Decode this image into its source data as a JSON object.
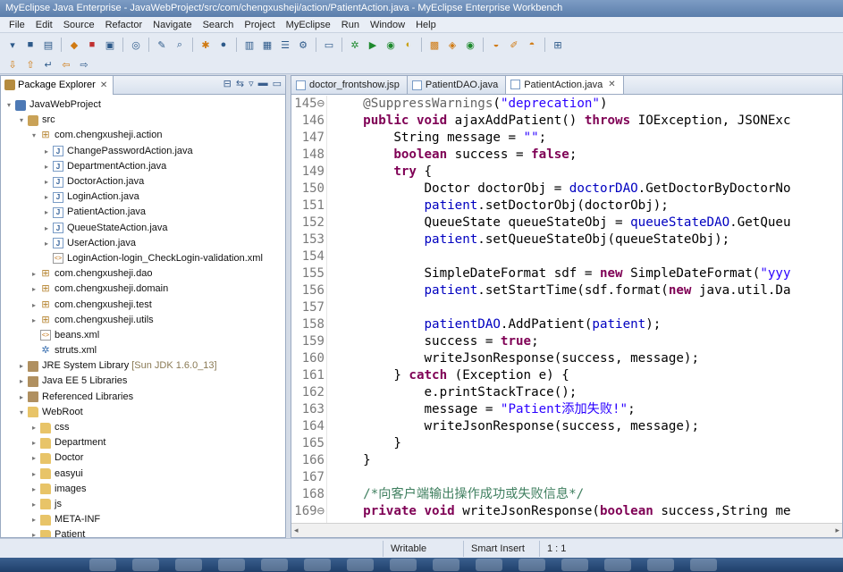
{
  "window": {
    "title": "MyEclipse Java Enterprise - JavaWebProject/src/com/chengxusheji/action/PatientAction.java - MyEclipse Enterprise Workbench"
  },
  "menu": [
    "File",
    "Edit",
    "Source",
    "Refactor",
    "Navigate",
    "Search",
    "Project",
    "MyEclipse",
    "Run",
    "Window",
    "Help"
  ],
  "explorer": {
    "title": "Package Explorer",
    "close": "✕",
    "items": [
      {
        "label": "JavaWebProject",
        "twisty": "▾",
        "icon": "project-icon",
        "indent": 0
      },
      {
        "label": "src",
        "twisty": "▾",
        "icon": "source-folder-icon",
        "indent": 1
      },
      {
        "label": "com.chengxusheji.action",
        "twisty": "▾",
        "icon": "package-icon",
        "indent": 2
      },
      {
        "label": "ChangePasswordAction.java",
        "twisty": "▸",
        "icon": "java-file-icon",
        "indent": 3
      },
      {
        "label": "DepartmentAction.java",
        "twisty": "▸",
        "icon": "java-file-icon",
        "indent": 3
      },
      {
        "label": "DoctorAction.java",
        "twisty": "▸",
        "icon": "java-file-icon",
        "indent": 3
      },
      {
        "label": "LoginAction.java",
        "twisty": "▸",
        "icon": "java-file-icon",
        "indent": 3
      },
      {
        "label": "PatientAction.java",
        "twisty": "▸",
        "icon": "java-file-icon",
        "indent": 3
      },
      {
        "label": "QueueStateAction.java",
        "twisty": "▸",
        "icon": "java-file-icon",
        "indent": 3
      },
      {
        "label": "UserAction.java",
        "twisty": "▸",
        "icon": "java-file-icon",
        "indent": 3
      },
      {
        "label": "LoginAction-login_CheckLogin-validation.xml",
        "twisty": "",
        "icon": "xml-file-icon",
        "indent": 3
      },
      {
        "label": "com.chengxusheji.dao",
        "twisty": "▸",
        "icon": "package-icon",
        "indent": 2
      },
      {
        "label": "com.chengxusheji.domain",
        "twisty": "▸",
        "icon": "package-icon",
        "indent": 2
      },
      {
        "label": "com.chengxusheji.test",
        "twisty": "▸",
        "icon": "package-icon",
        "indent": 2
      },
      {
        "label": "com.chengxusheji.utils",
        "twisty": "▸",
        "icon": "package-icon",
        "indent": 2
      },
      {
        "label": "beans.xml",
        "twisty": "",
        "icon": "xml-file-icon",
        "indent": 2
      },
      {
        "label": "struts.xml",
        "twisty": "",
        "icon": "struts-config-icon",
        "indent": 2
      },
      {
        "label": "JRE System Library",
        "decor": "[Sun JDK 1.6.0_13]",
        "twisty": "▸",
        "icon": "library-icon",
        "indent": 1
      },
      {
        "label": "Java EE 5 Libraries",
        "twisty": "▸",
        "icon": "library-icon",
        "indent": 1
      },
      {
        "label": "Referenced Libraries",
        "twisty": "▸",
        "icon": "library-icon",
        "indent": 1
      },
      {
        "label": "WebRoot",
        "twisty": "▾",
        "icon": "folder-icon",
        "indent": 1
      },
      {
        "label": "css",
        "twisty": "▸",
        "icon": "folder-icon",
        "indent": 2
      },
      {
        "label": "Department",
        "twisty": "▸",
        "icon": "folder-icon",
        "indent": 2
      },
      {
        "label": "Doctor",
        "twisty": "▸",
        "icon": "folder-icon",
        "indent": 2
      },
      {
        "label": "easyui",
        "twisty": "▸",
        "icon": "folder-icon",
        "indent": 2
      },
      {
        "label": "images",
        "twisty": "▸",
        "icon": "folder-icon",
        "indent": 2
      },
      {
        "label": "js",
        "twisty": "▸",
        "icon": "folder-icon",
        "indent": 2
      },
      {
        "label": "META-INF",
        "twisty": "▸",
        "icon": "folder-icon",
        "indent": 2
      },
      {
        "label": "Patient",
        "twisty": "▸",
        "icon": "folder-icon",
        "indent": 2
      }
    ]
  },
  "editor": {
    "tabs": [
      {
        "label": "doctor_frontshow.jsp",
        "active": false
      },
      {
        "label": "PatientDAO.java",
        "active": false
      },
      {
        "label": "PatientAction.java",
        "active": true,
        "close": "✕"
      }
    ],
    "lines": [
      {
        "num": "145⊖",
        "tokens": [
          [
            "    ",
            ""
          ],
          [
            "@SuppressWarnings",
            "ann"
          ],
          [
            "(",
            ""
          ],
          [
            "\"deprecation\"",
            "str"
          ],
          [
            ")",
            ""
          ]
        ]
      },
      {
        "num": "146",
        "tokens": [
          [
            "    ",
            ""
          ],
          [
            "public",
            "kw"
          ],
          [
            " ",
            ""
          ],
          [
            "void",
            "kw"
          ],
          [
            " ajaxAddPatient() ",
            ""
          ],
          [
            "throws",
            "kw"
          ],
          [
            " IOException, JSONExc",
            ""
          ]
        ]
      },
      {
        "num": "147",
        "tokens": [
          [
            "        String message = ",
            ""
          ],
          [
            "\"\"",
            "str"
          ],
          [
            ";",
            ""
          ]
        ]
      },
      {
        "num": "148",
        "tokens": [
          [
            "        ",
            ""
          ],
          [
            "boolean",
            "kw"
          ],
          [
            " success = ",
            ""
          ],
          [
            "false",
            "kw"
          ],
          [
            ";",
            ""
          ]
        ]
      },
      {
        "num": "149",
        "tokens": [
          [
            "        ",
            ""
          ],
          [
            "try",
            "kw"
          ],
          [
            " {",
            ""
          ]
        ]
      },
      {
        "num": "150",
        "tokens": [
          [
            "            Doctor doctorObj = ",
            ""
          ],
          [
            "doctorDAO",
            "fld"
          ],
          [
            ".GetDoctorByDoctorNo",
            ""
          ]
        ]
      },
      {
        "num": "151",
        "tokens": [
          [
            "            ",
            ""
          ],
          [
            "patient",
            "fld"
          ],
          [
            ".setDoctorObj(doctorObj);",
            ""
          ]
        ]
      },
      {
        "num": "152",
        "tokens": [
          [
            "            QueueState queueStateObj = ",
            ""
          ],
          [
            "queueStateDAO",
            "fld"
          ],
          [
            ".GetQueu",
            ""
          ]
        ]
      },
      {
        "num": "153",
        "tokens": [
          [
            "            ",
            ""
          ],
          [
            "patient",
            "fld"
          ],
          [
            ".setQueueStateObj(queueStateObj);",
            ""
          ]
        ]
      },
      {
        "num": "154",
        "tokens": [
          [
            "",
            ""
          ]
        ]
      },
      {
        "num": "155",
        "tokens": [
          [
            "            SimpleDateFormat sdf = ",
            ""
          ],
          [
            "new",
            "kw"
          ],
          [
            " SimpleDateFormat(",
            ""
          ],
          [
            "\"yyy",
            "str"
          ]
        ]
      },
      {
        "num": "156",
        "tokens": [
          [
            "            ",
            ""
          ],
          [
            "patient",
            "fld"
          ],
          [
            ".setStartTime(sdf.format(",
            ""
          ],
          [
            "new",
            "kw"
          ],
          [
            " java.util.Da",
            ""
          ]
        ]
      },
      {
        "num": "157",
        "tokens": [
          [
            "",
            ""
          ]
        ]
      },
      {
        "num": "158",
        "tokens": [
          [
            "            ",
            ""
          ],
          [
            "patientDAO",
            "fld"
          ],
          [
            ".AddPatient(",
            ""
          ],
          [
            "patient",
            "fld"
          ],
          [
            ");",
            ""
          ]
        ]
      },
      {
        "num": "159",
        "tokens": [
          [
            "            success = ",
            ""
          ],
          [
            "true",
            "kw"
          ],
          [
            ";",
            ""
          ]
        ]
      },
      {
        "num": "160",
        "tokens": [
          [
            "            writeJsonResponse(success, message);",
            ""
          ]
        ]
      },
      {
        "num": "161",
        "tokens": [
          [
            "        } ",
            ""
          ],
          [
            "catch",
            "kw"
          ],
          [
            " (Exception e) {",
            ""
          ]
        ]
      },
      {
        "num": "162",
        "tokens": [
          [
            "            e.printStackTrace();",
            ""
          ]
        ]
      },
      {
        "num": "163",
        "tokens": [
          [
            "            message = ",
            ""
          ],
          [
            "\"Patient添加失败!\"",
            "str"
          ],
          [
            ";",
            ""
          ]
        ]
      },
      {
        "num": "164",
        "tokens": [
          [
            "            writeJsonResponse(success, message);",
            ""
          ]
        ]
      },
      {
        "num": "165",
        "tokens": [
          [
            "        }",
            ""
          ]
        ]
      },
      {
        "num": "166",
        "tokens": [
          [
            "    }",
            ""
          ]
        ]
      },
      {
        "num": "167",
        "tokens": [
          [
            "",
            ""
          ]
        ]
      },
      {
        "num": "168",
        "tokens": [
          [
            "    ",
            ""
          ],
          [
            "/*向客户端输出操作成功或失败信息*/",
            "cmt"
          ]
        ]
      },
      {
        "num": "169⊖",
        "tokens": [
          [
            "    ",
            ""
          ],
          [
            "private",
            "kw"
          ],
          [
            " ",
            ""
          ],
          [
            "void",
            "kw"
          ],
          [
            " writeJsonResponse(",
            ""
          ],
          [
            "boolean",
            "kw"
          ],
          [
            " success,String me",
            ""
          ]
        ]
      }
    ]
  },
  "status": {
    "writable": "Writable",
    "insert_mode": "Smart Insert",
    "position": "1 : 1"
  }
}
